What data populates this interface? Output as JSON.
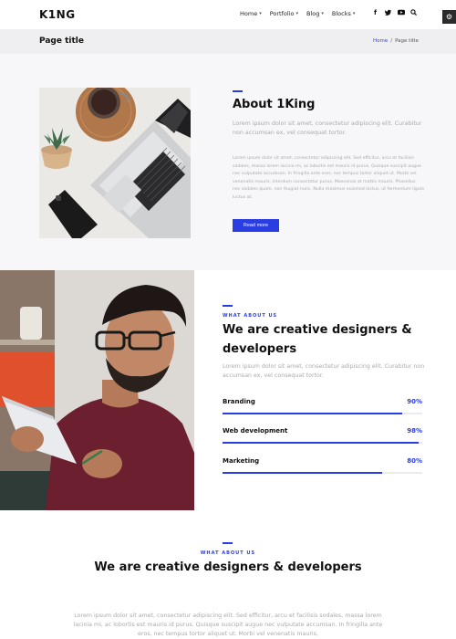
{
  "header": {
    "logo": "K1NG",
    "nav": [
      {
        "label": "Home"
      },
      {
        "label": "Portfolio"
      },
      {
        "label": "Blog"
      },
      {
        "label": "Blocks"
      }
    ],
    "social_icons": [
      "facebook-icon",
      "twitter-icon",
      "youtube-icon",
      "search-icon"
    ],
    "settings_icon": "gear-icon"
  },
  "titlebar": {
    "title": "Page title",
    "breadcrumb_home": "Home",
    "breadcrumb_sep": "/",
    "breadcrumb_current": "Page title"
  },
  "about": {
    "heading": "About 1King",
    "lead": "Lorem ipsum dolor sit amet, consectetur adipiscing elit. Curabitur non accumsan ex, vel consequat tortor.",
    "body": "Lorem ipsum dolor sit amet, consectetur adipiscing elit. Sed efficitur, arcu et facilisis sodales, massa lorem lacinia mi, ac lobortis est mauris id purus. Quisque suscipit augue nec vulputate accumsan. In fringilla ante eros, nec tempus tortor aliquet ut. Morbi vel venenatis mauris, interdum consectetur purus. Maecenas at mattis mauris. Phasellus nec sodales quam, non feugiat nunc. Nulla maximus euismod lectus, ut fermentum ligula luctus at.",
    "button": "Read more"
  },
  "creative": {
    "eyebrow": "WHAT ABOUT US",
    "heading": "We are creative designers & developers",
    "lead": "Lorem ipsum dolor sit amet, consectetur adipiscing elit. Curabitur non accumsan ex, vel consequat tortor.",
    "skills": [
      {
        "name": "Branding",
        "percent_label": "90%",
        "level": 0.9
      },
      {
        "name": "Web development",
        "percent_label": "98%",
        "level": 0.98
      },
      {
        "name": "Marketing",
        "percent_label": "80%",
        "level": 0.8
      }
    ]
  },
  "bottom": {
    "eyebrow": "WHAT ABOUT US",
    "heading": "We are creative designers & developers",
    "body": "Lorem ipsum dolor sit amet, consectetur adipiscing elit. Sed efficitur, arcu et facilisis sodales, massa lorem lacinia mi, ac lobortis est mauris id purus. Quisque suscipit augue nec vulputate accumsan. In fringilla ante eros, nec tempus tortor aliquet ut. Morbi vel venenatis mauris,"
  },
  "colors": {
    "accent": "#2a3de0",
    "title_bar": "#efeff1",
    "muted_text": "#aaaaaa"
  }
}
